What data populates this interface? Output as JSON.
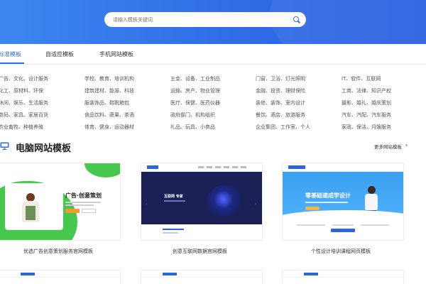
{
  "search": {
    "placeholder": "请输入模板关键词"
  },
  "tabs": [
    {
      "label": "标准模板",
      "active": true
    },
    {
      "label": "自适应模板",
      "active": false
    },
    {
      "label": "手机网站模板",
      "active": false
    }
  ],
  "categories": [
    [
      "广告、文化、设计服务",
      "学校、教育、培训机构",
      "五金、设备、工业制品",
      "门窗、卫浴、灯光照明",
      "IT、软件、互联网"
    ],
    [
      "化工、原材料、环保",
      "建筑建材、能源、科技",
      "运输、房产、物业管理",
      "金融、投资、理财保险",
      "工商、法律、知识产权"
    ],
    [
      "休闲、娱乐、生活服务",
      "服装饰品、鞋靴箱包",
      "医疗、保健、医药仪器",
      "装修、装饰、室内设计",
      "摄影、婚礼、婚庆策划"
    ],
    [
      "数码、家具、家居百货",
      "食品饮料、蔬果、茶酒",
      "政府部门、机构组织",
      "餐饮、酒店、旅游服务",
      "汽车、汽配、汽车服务"
    ],
    [
      "农业畜牧、种植养殖",
      "体育、健身、运动器材",
      "礼品、玩具、小商品",
      "企业集团、工作室、个人",
      "家政、保洁、月嫂服务"
    ]
  ],
  "section": {
    "title": "电脑网站模板",
    "more": "更多网站模板",
    "icon": "monitor-icon"
  },
  "cards": [
    {
      "title": "优选广告创意策划服务官网模板",
      "banner_text": "广告·创意策划"
    },
    {
      "title": "创意互联网数据官网模板",
      "banner_text": "互联网 专家"
    },
    {
      "title": "个性设计培训课程网页模板",
      "banner_text": "零基础速成学设计"
    }
  ],
  "colors": {
    "accent": "#2f6de6",
    "hero": "#3d86f0",
    "green": "#45c84c",
    "navy": "#1a1f55"
  }
}
